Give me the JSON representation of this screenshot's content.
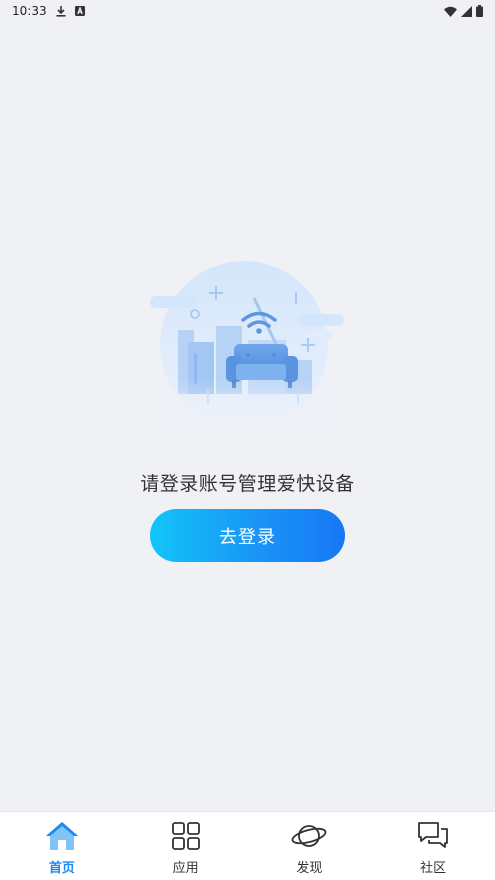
{
  "status_bar": {
    "time": "10:33",
    "left_icons": [
      "download-icon",
      "a-badge-icon"
    ],
    "right_icons": [
      "wifi-icon",
      "cell-signal-icon",
      "battery-icon"
    ]
  },
  "main": {
    "illustration": "smart-home-sofa-wifi-illustration",
    "prompt": "请登录账号管理爱快设备",
    "login_button": "去登录"
  },
  "bottom_nav": {
    "items": [
      {
        "label": "首页",
        "icon": "home-icon",
        "active": true
      },
      {
        "label": "应用",
        "icon": "apps-grid-icon",
        "active": false
      },
      {
        "label": "发现",
        "icon": "planet-icon",
        "active": false
      },
      {
        "label": "社区",
        "icon": "chat-bubbles-icon",
        "active": false
      }
    ]
  },
  "colors": {
    "background": "#f0f1f5",
    "accent": "#1a8cf0",
    "button_gradient_start": "#12c5f8",
    "button_gradient_end": "#1677f5"
  }
}
